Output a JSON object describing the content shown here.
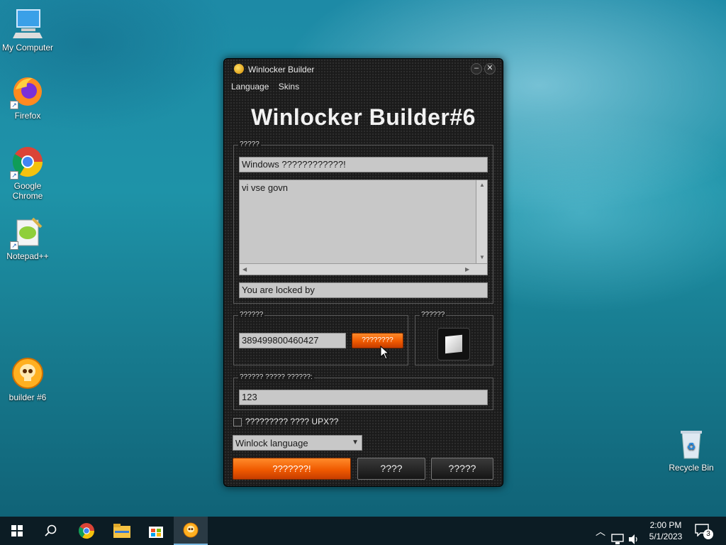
{
  "desktop": {
    "icons": [
      {
        "label": "My Computer"
      },
      {
        "label": "Firefox"
      },
      {
        "label": "Google Chrome"
      },
      {
        "label": "Notepad++"
      },
      {
        "label": "builder #6"
      },
      {
        "label": "Recycle Bin"
      }
    ]
  },
  "window": {
    "title": "Winlocker Builder",
    "menu": [
      "Language",
      "Skins"
    ],
    "heading": "Winlocker Builder#6",
    "group1": {
      "label": "?????",
      "title_value": "Windows ????????????!",
      "message_value": "vi vse govn",
      "footer_value": "You are locked by"
    },
    "group2": {
      "label": "??????",
      "code_value": "389499800460427",
      "generate_label": "????????"
    },
    "group3": {
      "label": "??????"
    },
    "group4": {
      "label": "?????? ????? ??????:",
      "value": "123"
    },
    "upx_label": "????????? ???? UPX??",
    "language_select": "Winlock language",
    "build_label": "???????!",
    "test_label": "????",
    "about_label": "?????"
  },
  "taskbar": {
    "time": "2:00 PM",
    "date": "5/1/2023",
    "notification_count": "3"
  },
  "colors": {
    "accent_orange": "#f05a00",
    "window_bg": "#1b1b1b",
    "taskbar_bg": "#0c1c24"
  }
}
